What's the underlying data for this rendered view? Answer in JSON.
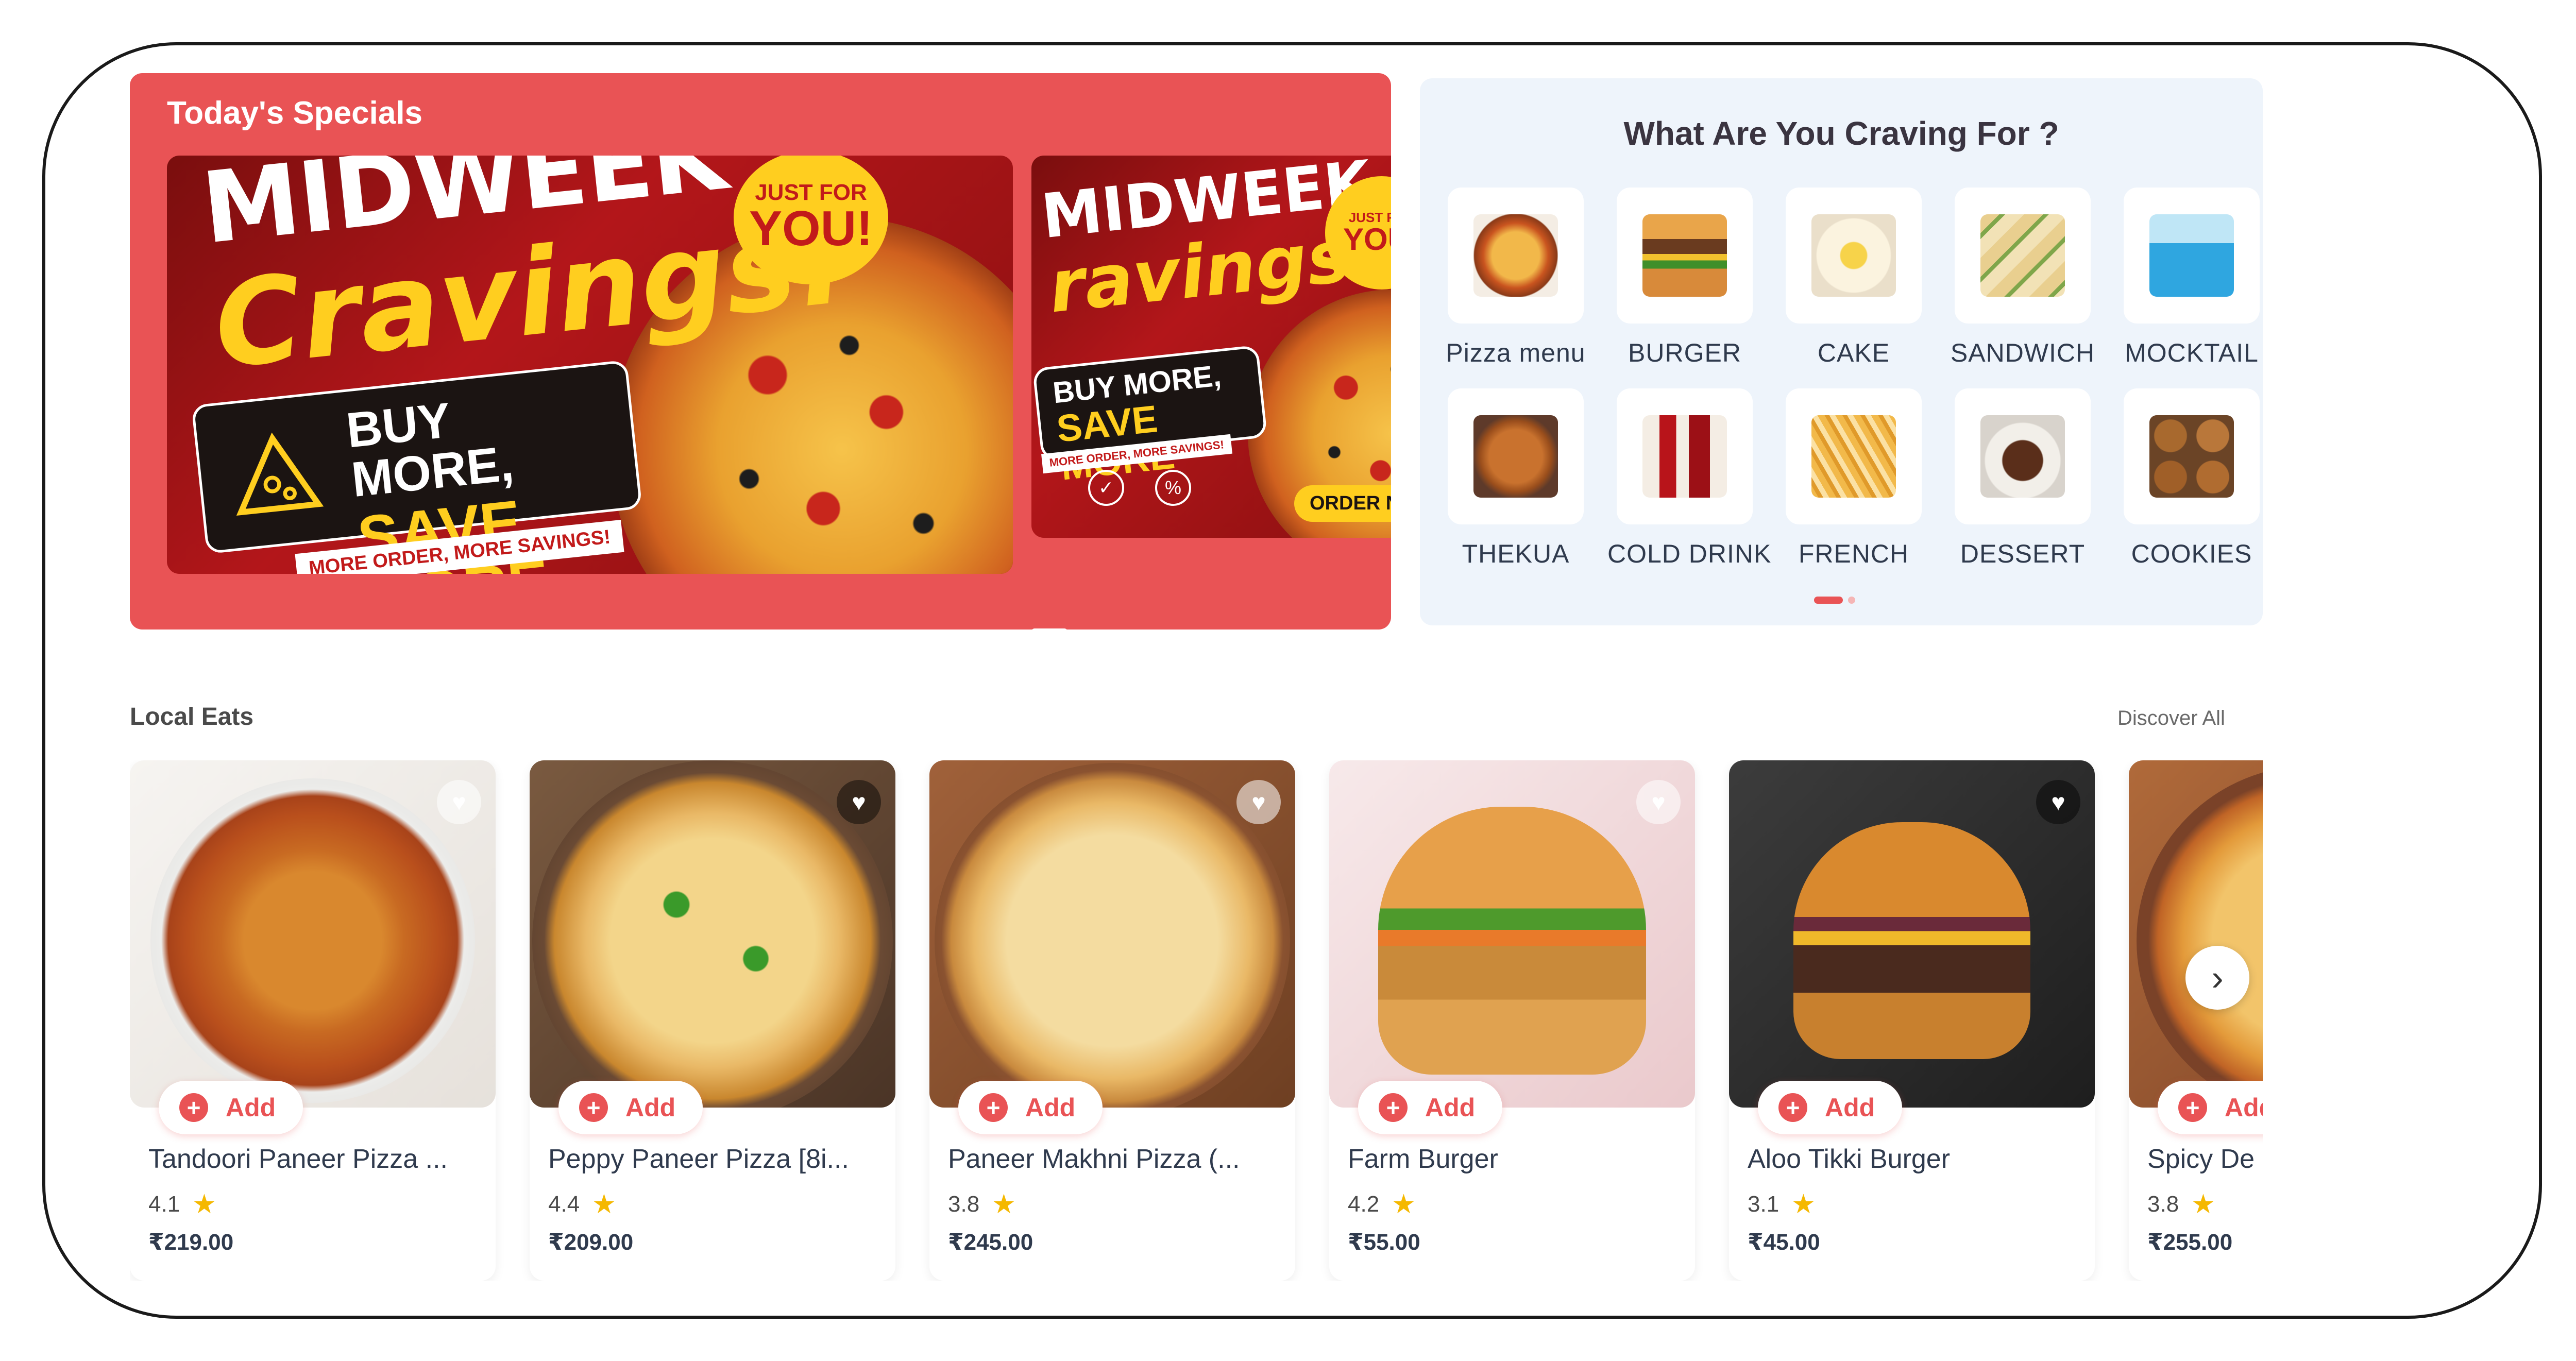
{
  "specials": {
    "title": "Today's Specials",
    "banner1": {
      "headline_line1": "MIDWEEK",
      "headline_line2": "Cravings!",
      "badge_small": "JUST FOR",
      "badge_large": "YOU!",
      "promo_line1": "BUY MORE,",
      "promo_line2": "SAVE MORE",
      "tagline": "MORE ORDER, MORE SAVINGS!"
    },
    "banner2": {
      "headline_line1": "MIDWEEK",
      "headline_line2": "ravings!",
      "badge_small": "JUST FOR",
      "badge_large": "YOU!",
      "promo_line1": "BUY MORE,",
      "promo_line2": "SAVE MORE",
      "tagline": "MORE ORDER, MORE SAVINGS!",
      "order_label": "ORDER NOW"
    }
  },
  "cravings": {
    "title": "What Are You Craving For ?",
    "categories": [
      {
        "label": "Pizza menu",
        "icon": "pizza-icon"
      },
      {
        "label": "BURGER",
        "icon": "burger-icon"
      },
      {
        "label": "CAKE",
        "icon": "cake-icon"
      },
      {
        "label": "SANDWICH",
        "icon": "sandwich-icon"
      },
      {
        "label": "MOCKTAIL",
        "icon": "mocktail-icon"
      },
      {
        "label": "THEKUA",
        "icon": "thekua-icon"
      },
      {
        "label": "COLD DRINK",
        "icon": "cold-drink-icon"
      },
      {
        "label": "FRENCH",
        "icon": "french-fries-icon"
      },
      {
        "label": "DESSERT",
        "icon": "dessert-icon"
      },
      {
        "label": "COOKIES",
        "icon": "cookies-icon"
      }
    ]
  },
  "local_eats": {
    "title": "Local Eats",
    "discover_label": "Discover All",
    "add_label": "Add",
    "items": [
      {
        "name": "Tandoori Paneer Pizza ...",
        "rating": "4.1",
        "price": "₹219.00"
      },
      {
        "name": "Peppy Paneer Pizza [8i...",
        "rating": "4.4",
        "price": "₹209.00"
      },
      {
        "name": "Paneer Makhni Pizza (...",
        "rating": "3.8",
        "price": "₹245.00"
      },
      {
        "name": "Farm Burger",
        "rating": "4.2",
        "price": "₹55.00"
      },
      {
        "name": "Aloo Tikki  Burger",
        "rating": "3.1",
        "price": "₹45.00"
      },
      {
        "name": "Spicy De",
        "rating": "3.8",
        "price": "₹255.00"
      }
    ]
  },
  "colors": {
    "accent": "#e95355",
    "cravings_bg": "#eef4fb",
    "star": "#f5b800"
  }
}
